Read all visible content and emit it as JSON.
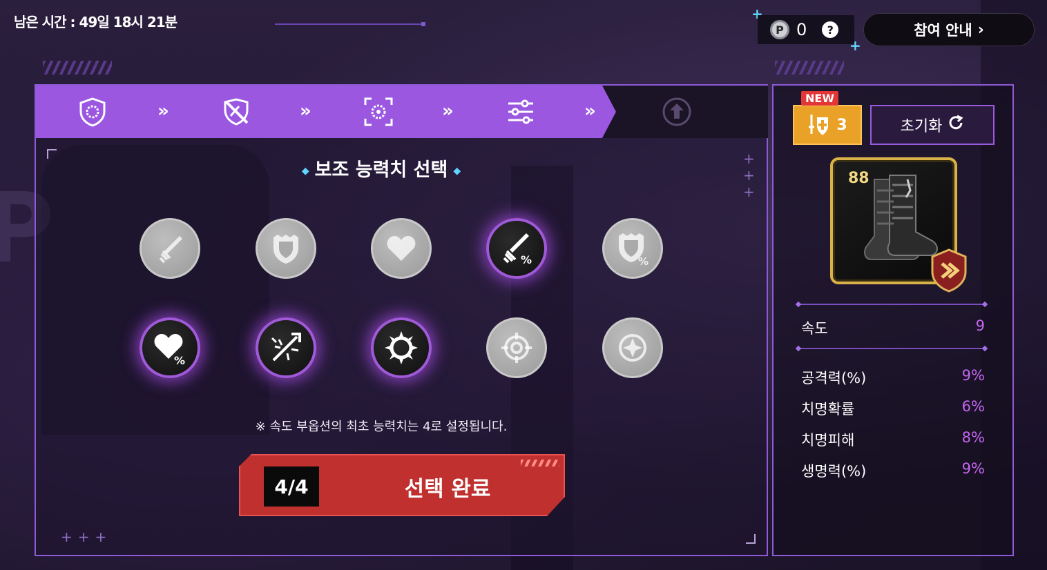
{
  "header": {
    "timer": "남은 시간 : 49일 18시 21분",
    "coin_value": "0",
    "coin_icon": "P",
    "help_icon": "?",
    "guide_button": "참여 안내"
  },
  "steps": {
    "icons": [
      "ring-shield-icon",
      "slashed-shield-sword-icon",
      "target-focus-icon",
      "sliders-icon",
      "upgrade-icon"
    ],
    "arrow": "»"
  },
  "selection": {
    "title": "보조 능력치 선택",
    "note": "※ 속도 부옵션의 최초 능력치는 4로 설정됩니다.",
    "options": [
      {
        "name": "attack",
        "selected": false
      },
      {
        "name": "defense",
        "selected": false
      },
      {
        "name": "health",
        "selected": false
      },
      {
        "name": "attack-percent",
        "selected": true
      },
      {
        "name": "defense-percent",
        "selected": false
      },
      {
        "name": "health-percent",
        "selected": true
      },
      {
        "name": "crit-rate",
        "selected": true
      },
      {
        "name": "crit-damage",
        "selected": true
      },
      {
        "name": "effectiveness",
        "selected": false
      },
      {
        "name": "effect-resistance",
        "selected": false
      }
    ],
    "count": "4/4",
    "confirm_label": "선택 완료"
  },
  "side": {
    "new_tag": "NEW",
    "badge_count": "3",
    "reset_label": "초기화",
    "item_level": "88",
    "main_stat": {
      "label": "속도",
      "value": "9"
    },
    "sub_stats": [
      {
        "label": "공격력(%)",
        "value": "9%"
      },
      {
        "label": "치명확률",
        "value": "6%"
      },
      {
        "label": "치명피해",
        "value": "8%"
      },
      {
        "label": "생명력(%)",
        "value": "9%"
      }
    ]
  },
  "colors": {
    "accent_purple": "#9b57e0",
    "confirm_red": "#c0302f",
    "value_purple": "#c466f0",
    "badge_gold": "#e9a227"
  }
}
